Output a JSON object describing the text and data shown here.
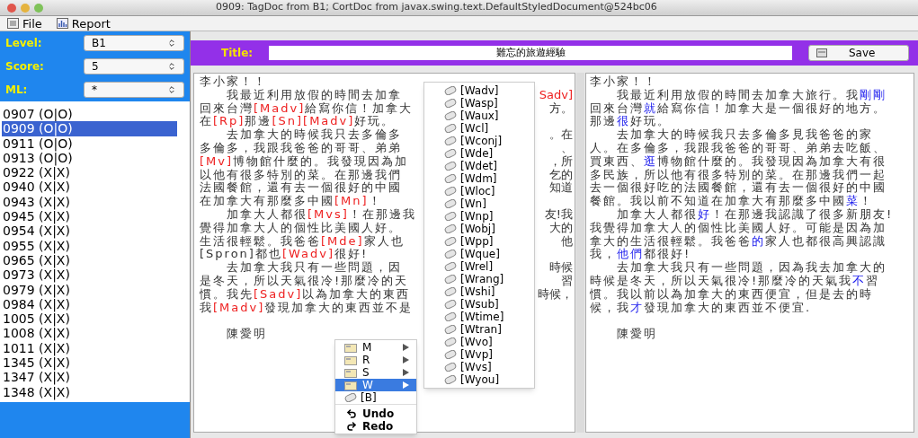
{
  "window": {
    "title": "0909: TagDoc from B1; CortDoc from javax.swing.text.DefaultStyledDocument@524bc06"
  },
  "menu_bar": [
    {
      "label": "File",
      "kind": "file"
    },
    {
      "label": "Report",
      "kind": "report"
    }
  ],
  "filters": [
    {
      "label": "Level:",
      "value": "B1"
    },
    {
      "label": "Score:",
      "value": "5"
    },
    {
      "label": "ML:",
      "value": "*"
    }
  ],
  "documents": [
    {
      "label": "0907 (O|O)",
      "selected": false
    },
    {
      "label": "0909 (O|O)",
      "selected": true
    },
    {
      "label": "0911 (O|O)",
      "selected": false
    },
    {
      "label": "0913 (O|O)",
      "selected": false
    },
    {
      "label": "0922 (X|X)",
      "selected": false
    },
    {
      "label": "0940 (X|X)",
      "selected": false
    },
    {
      "label": "0943 (X|X)",
      "selected": false
    },
    {
      "label": "0945 (X|X)",
      "selected": false
    },
    {
      "label": "0954 (X|X)",
      "selected": false
    },
    {
      "label": "0955 (X|X)",
      "selected": false
    },
    {
      "label": "0965 (X|X)",
      "selected": false
    },
    {
      "label": "0973 (X|X)",
      "selected": false
    },
    {
      "label": "0979 (X|X)",
      "selected": false
    },
    {
      "label": "0984 (X|X)",
      "selected": false
    },
    {
      "label": "1005 (X|X)",
      "selected": false
    },
    {
      "label": "1008 (X|X)",
      "selected": false
    },
    {
      "label": "1011 (X|X)",
      "selected": false
    },
    {
      "label": "1345 (X|X)",
      "selected": false
    },
    {
      "label": "1347 (X|X)",
      "selected": false
    },
    {
      "label": "1348 (X|X)",
      "selected": false
    }
  ],
  "title_bar": {
    "label": "Title:",
    "value": "難忘的旅遊經驗",
    "save_button": "Save"
  },
  "tagged_text": [
    {
      "segments": [
        {
          "text": "李小家！！",
          "tag": false
        }
      ]
    },
    {
      "segments": [
        {
          "text": "　　我最近利用放假的時間去加拿",
          "tag": false
        }
      ],
      "fragment": {
        "text": "Sadv]",
        "tag": true
      }
    },
    {
      "segments": [
        {
          "text": "回來台灣",
          "tag": false
        },
        {
          "text": "[Madv]",
          "tag": true
        },
        {
          "text": "給寫你信！加拿大",
          "tag": false
        }
      ],
      "fragment": {
        "text": "方。",
        "tag": false
      }
    },
    {
      "segments": [
        {
          "text": "在",
          "tag": false
        },
        {
          "text": "[Rp]",
          "tag": true
        },
        {
          "text": "那邊",
          "tag": false
        },
        {
          "text": "[Sn][Madv]",
          "tag": true
        },
        {
          "text": "好玩。",
          "tag": false
        }
      ]
    },
    {
      "segments": [
        {
          "text": "　　去加拿大的時候我只去多倫多",
          "tag": false
        }
      ],
      "fragment": {
        "text": "。在",
        "tag": false
      }
    },
    {
      "segments": [
        {
          "text": "多倫多，我跟我爸爸的哥哥、弟弟",
          "tag": false
        }
      ],
      "fragment": {
        "text": "、",
        "tag": false
      }
    },
    {
      "segments": [
        {
          "text": "[Mv]",
          "tag": true
        },
        {
          "text": "博物館什麼的。我發現因為加",
          "tag": false
        }
      ],
      "fragment": {
        "text": "，所",
        "tag": false
      }
    },
    {
      "segments": [
        {
          "text": "以他有很多特別的菜。在那邊我們",
          "tag": false
        }
      ],
      "fragment": {
        "text": "乞的",
        "tag": false
      }
    },
    {
      "segments": [
        {
          "text": "法國餐館，還有去一個很好的中國",
          "tag": false
        }
      ],
      "fragment": {
        "text": "知道",
        "tag": false
      }
    },
    {
      "segments": [
        {
          "text": "在加拿大有那麼多中國",
          "tag": false
        },
        {
          "text": "[Mn]",
          "tag": true
        },
        {
          "text": "！",
          "tag": false
        }
      ]
    },
    {
      "segments": [
        {
          "text": "　　加拿大人都很",
          "tag": false
        },
        {
          "text": "[Mvs]",
          "tag": true
        },
        {
          "text": "！在那邊我",
          "tag": false
        }
      ],
      "fragment": {
        "text": "友!我",
        "tag": false
      }
    },
    {
      "segments": [
        {
          "text": "覺得加拿大人的個性比美國人好。",
          "tag": false
        }
      ],
      "fragment": {
        "text": "大的",
        "tag": false
      }
    },
    {
      "segments": [
        {
          "text": "生活很輕鬆。我爸爸",
          "tag": false
        },
        {
          "text": "[Mde]",
          "tag": true
        },
        {
          "text": "家人也",
          "tag": false
        }
      ],
      "fragment": {
        "text": "他",
        "tag": false
      }
    },
    {
      "segments": [
        {
          "text": "[Spron]都也",
          "tag": false
        },
        {
          "text": "[Wadv]",
          "tag": true
        },
        {
          "text": "很好!",
          "tag": false
        }
      ]
    },
    {
      "segments": [
        {
          "text": "　　去加拿大我只有一些問題，因",
          "tag": false
        }
      ],
      "fragment": {
        "text": "時候",
        "tag": false
      }
    },
    {
      "segments": [
        {
          "text": "是冬天，所以天氣很冷!那麼冷的天",
          "tag": false
        }
      ],
      "fragment": {
        "text": "習",
        "tag": false
      }
    },
    {
      "segments": [
        {
          "text": "慣。我先",
          "tag": false
        },
        {
          "text": "[Sadv]",
          "tag": true
        },
        {
          "text": "以為加拿大的東西",
          "tag": false
        }
      ],
      "fragment": {
        "text": "時候，",
        "tag": false
      }
    },
    {
      "segments": [
        {
          "text": "我",
          "tag": false
        },
        {
          "text": "[Madv]",
          "tag": true
        },
        {
          "text": "發現加拿大的東西並不是",
          "tag": false
        }
      ]
    },
    {
      "segments": [
        {
          "text": "　　陳愛明",
          "tag": false
        }
      ],
      "kind": "signature"
    }
  ],
  "corrected_text": [
    {
      "segments": [
        {
          "text": "李小家！！",
          "changed": false
        }
      ]
    },
    {
      "segments": [
        {
          "text": "　　我最近利用放假的時間去加拿大旅行。我",
          "changed": false
        },
        {
          "text": "剛剛",
          "changed": true
        }
      ]
    },
    {
      "segments": [
        {
          "text": "回來台灣",
          "changed": false
        },
        {
          "text": "就",
          "changed": true
        },
        {
          "text": "給寫你信！加拿大是一個很好的地方。",
          "changed": false
        }
      ]
    },
    {
      "segments": [
        {
          "text": "那邊",
          "changed": false
        },
        {
          "text": "很",
          "changed": true
        },
        {
          "text": "好玩。",
          "changed": false
        }
      ]
    },
    {
      "segments": [
        {
          "text": "　　去加拿大的時候我只去多倫多見我爸爸的家",
          "changed": false
        }
      ]
    },
    {
      "segments": [
        {
          "text": "人。在多倫多，我跟我爸爸的哥哥、弟弟去吃飯、",
          "changed": false
        }
      ]
    },
    {
      "segments": [
        {
          "text": "買東西、",
          "changed": false
        },
        {
          "text": "逛",
          "changed": true
        },
        {
          "text": "博物館什麼的。我發現因為加拿大有很",
          "changed": false
        }
      ]
    },
    {
      "segments": [
        {
          "text": "多民族，所以他有很多特別的菜。在那邊我們一起",
          "changed": false
        }
      ]
    },
    {
      "segments": [
        {
          "text": "去一個很好吃的法國餐館，還有去一個很好的中國",
          "changed": false
        }
      ]
    },
    {
      "segments": [
        {
          "text": "餐館。我以前不知道在加拿大有那麼多中國",
          "changed": false
        },
        {
          "text": "菜",
          "changed": true
        },
        {
          "text": "！",
          "changed": false
        }
      ]
    },
    {
      "segments": [
        {
          "text": "　　加拿大人都很",
          "changed": false
        },
        {
          "text": "好",
          "changed": true
        },
        {
          "text": "！在那邊我認識了很多新朋友!",
          "changed": false
        }
      ]
    },
    {
      "segments": [
        {
          "text": "我覺得加拿大人的個性比美國人好。可能是因為加",
          "changed": false
        }
      ]
    },
    {
      "segments": [
        {
          "text": "拿大的生活很輕鬆。我爸爸",
          "changed": false
        },
        {
          "text": "的",
          "changed": true
        },
        {
          "text": "家人也都很高興認識",
          "changed": false
        }
      ]
    },
    {
      "segments": [
        {
          "text": "我，",
          "changed": false
        },
        {
          "text": "他們",
          "changed": true
        },
        {
          "text": "都很好!",
          "changed": false
        }
      ]
    },
    {
      "segments": [
        {
          "text": "　　去加拿大我只有一些問題，因為我去加拿大的",
          "changed": false
        }
      ]
    },
    {
      "segments": [
        {
          "text": "時候是冬天，所以天氣很冷!那麼冷的天氣我",
          "changed": false
        },
        {
          "text": "不",
          "changed": true
        },
        {
          "text": "習",
          "changed": false
        }
      ]
    },
    {
      "segments": [
        {
          "text": "慣。我以前以為加拿大的東西便宜，但是去的時",
          "changed": false
        }
      ]
    },
    {
      "segments": [
        {
          "text": "候，我",
          "changed": false
        },
        {
          "text": "才",
          "changed": true
        },
        {
          "text": "發現加拿大的東西並不便宜.",
          "changed": false
        }
      ]
    },
    {
      "segments": [
        {
          "text": "　　陳愛明",
          "changed": false
        }
      ],
      "kind": "signature"
    }
  ],
  "context_menu": [
    {
      "label": "M",
      "kind": "category",
      "selected": false
    },
    {
      "label": "R",
      "kind": "category",
      "selected": false
    },
    {
      "label": "S",
      "kind": "category",
      "selected": false
    },
    {
      "label": "W",
      "kind": "category",
      "selected": true
    },
    {
      "label": "[B]",
      "kind": "tag",
      "selected": false
    },
    {
      "label": "Undo",
      "kind": "undo",
      "selected": false
    },
    {
      "label": "Redo",
      "kind": "redo",
      "selected": false
    }
  ],
  "submenu": [
    "[Wadv]",
    "[Wasp]",
    "[Waux]",
    "[Wcl]",
    "[Wconj]",
    "[Wde]",
    "[Wdet]",
    "[Wdm]",
    "[Wloc]",
    "[Wn]",
    "[Wnp]",
    "[Wobj]",
    "[Wpp]",
    "[Wque]",
    "[Wrel]",
    "[Wrang]",
    "[Wshi]",
    "[Wsub]",
    "[Wtime]",
    "[Wtran]",
    "[Wvo]",
    "[Wvp]",
    "[Wvs]",
    "[Wyou]"
  ]
}
